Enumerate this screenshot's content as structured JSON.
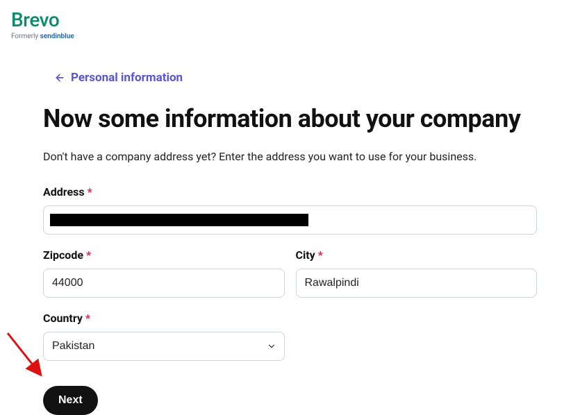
{
  "brand": {
    "name": "Brevo",
    "subline_prefix": "Formerly ",
    "subline_accent": "sendinblue"
  },
  "nav": {
    "back_label": "Personal information"
  },
  "page": {
    "title": "Now some information about your company",
    "subtitle": "Don't have a company address yet? Enter the address you want to use for your business."
  },
  "form": {
    "address": {
      "label": "Address",
      "value": ""
    },
    "zipcode": {
      "label": "Zipcode",
      "value": "44000"
    },
    "city": {
      "label": "City",
      "value": "Rawalpindi"
    },
    "country": {
      "label": "Country",
      "value": "Pakistan"
    },
    "next_label": "Next"
  }
}
